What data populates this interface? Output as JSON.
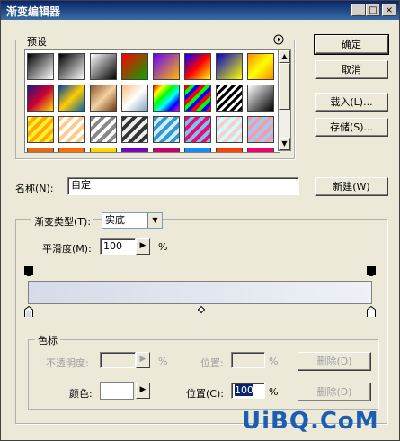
{
  "window": {
    "title": "渐变编辑器",
    "minimize": "_",
    "maximize": "□",
    "close": "×"
  },
  "presets": {
    "label": "预设",
    "menu_icon": "play-circle-icon",
    "swatches": [
      "linear-gradient(135deg,#000,#fff)",
      "linear-gradient(135deg,#000,rgba(255,255,255,0))",
      "linear-gradient(135deg,#fff,#000)",
      "linear-gradient(135deg,#f00,#0a0)",
      "linear-gradient(135deg,#60f,#fb0)",
      "linear-gradient(135deg,#00f,#f00,#ff0)",
      "linear-gradient(135deg,#00c,#ff0)",
      "linear-gradient(135deg,#f80,#ff0,#f80)",
      "linear-gradient(135deg,#1a1a80,#c03,#fd0)",
      "linear-gradient(135deg,#04a,#fc0,#06a)",
      "linear-gradient(135deg,#8a5a2a,#f4d0a0,#6a3a10)",
      "linear-gradient(135deg,#f4c080,#fff,#80a0c0)",
      "linear-gradient(135deg,#f00,#ff0,#0f0,#0ff,#00f,#f0f)",
      "repeating-linear-gradient(135deg,#f00 0 4px,#0f0 4px 8px,#00f 8px 12px)",
      "repeating-linear-gradient(135deg,#000 0 3px,#fff 3px 6px)",
      "linear-gradient(135deg,#fff,#000)",
      "repeating-linear-gradient(135deg,#fe3 0 4px,#fa0 4px 8px)",
      "repeating-linear-gradient(135deg,#fc8 0 4px,#fff3 4px 8px)",
      "repeating-linear-gradient(135deg,#888 0 4px,#fff 4px 8px)",
      "repeating-linear-gradient(135deg,#333 0 4px,#eee 4px 8px)",
      "repeating-linear-gradient(135deg,#39c 0 4px,#cef 4px 8px)",
      "repeating-linear-gradient(135deg,#f06 0 4px,#6cf 4px 8px)",
      "repeating-linear-gradient(135deg,#fcc 0 4px,#cff 4px 8px)",
      "repeating-linear-gradient(135deg,#f99 0 4px,#9cf 4px 8px)",
      "linear-gradient(180deg,#f60,#06c)",
      "linear-gradient(180deg,#f60,#fc0)",
      "linear-gradient(180deg,#fd0,#f60)",
      "linear-gradient(180deg,#60c,#f60)",
      "linear-gradient(180deg,#c06,#60c)",
      "linear-gradient(180deg,#09f,#f0c)",
      "linear-gradient(180deg,#f30,#fc0)",
      "linear-gradient(180deg,#f06,#60f)"
    ]
  },
  "buttons": {
    "ok": "确定",
    "cancel": "取消",
    "load": "载入(L)...",
    "save": "存储(S)...",
    "new": "新建(W)"
  },
  "name": {
    "label": "名称(N):",
    "value": "自定"
  },
  "gradient_type": {
    "label": "渐变类型(T):",
    "value": "实底"
  },
  "smoothness": {
    "label": "平滑度(M):",
    "value": "100",
    "unit": "%"
  },
  "gradient": {
    "start_color": "#d5dbe8",
    "end_color": "#eef1f7"
  },
  "color_stops": {
    "group_label": "色标",
    "opacity_label": "不透明度:",
    "opacity_unit": "%",
    "opacity_location_label": "位置:",
    "opacity_location_unit": "%",
    "opacity_delete": "删除(D)",
    "color_label": "颜色:",
    "color_value": "#ffffff",
    "location_label": "位置(C):",
    "location_value": "100",
    "location_unit": "%",
    "delete": "删除(D)"
  },
  "watermark": "UiBQ.CoM"
}
